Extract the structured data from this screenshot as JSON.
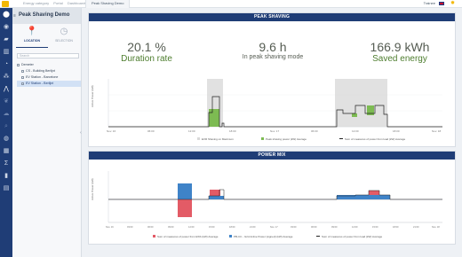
{
  "topbar": {
    "breadcrumbs": [
      "Energy category",
      "Portal",
      "Dashboards"
    ],
    "doc_tab": "Peak Shaving Demo",
    "user": "Trainee"
  },
  "rail_icons": [
    "location-icon",
    "globe-icon",
    "folder-icon",
    "chart-icon",
    "gauge-icon",
    "nodes-icon",
    "peak-icon",
    "leaf-icon",
    "cloud-icon",
    "search-icon",
    "meter-icon",
    "grid-icon",
    "sigma-icon",
    "battery-icon",
    "table-icon"
  ],
  "sidebar": {
    "title": "Peak Shaving Demo",
    "tab_location": "LOCATION",
    "tab_selection": "SELECTION",
    "search_placeholder": "Search",
    "tree": [
      {
        "label": "Demeter",
        "level": 0
      },
      {
        "label": "CS - Building Berlijnt",
        "level": 1
      },
      {
        "label": "EV Station - Barcelone",
        "level": 1
      },
      {
        "label": "EV Station - Berlijnt",
        "level": 1
      }
    ]
  },
  "peak": {
    "title": "PEAK SHAVING",
    "kpis": [
      {
        "value": "20.1 %",
        "label": "Duration rate"
      },
      {
        "value": "9.6 h",
        "label": "In peak shaving mode"
      },
      {
        "value": "166.9 kWh",
        "label": "Saved energy"
      }
    ],
    "chart": {
      "ylabel": "Active Power (kW)",
      "x_ticks": [
        "Nov. 16",
        "06:00",
        "12:00",
        "18:00",
        "Nov. 17",
        "06:00",
        "12:00",
        "18:00",
        "Nov. 18"
      ],
      "legend": [
        "EVR Shaving on Maximum",
        "Peak shaving power (kW) Average",
        "Sum of measures of power from load (kW) Average"
      ]
    }
  },
  "mix": {
    "title": "POWER MIX",
    "chart": {
      "ylabel": "Active Power (kW)",
      "x_ticks": [
        "Nov. 16",
        "03:00",
        "06:00",
        "09:00",
        "12:00",
        "15:00",
        "18:00",
        "21:00",
        "Nov. 17",
        "03:00",
        "06:00",
        "09:00",
        "12:00",
        "15:00",
        "18:00",
        "21:00",
        "Nov. 18"
      ],
      "legend": [
        "Sum of measures of power from ESS (kW) Average",
        "PB-CC - Grid Active Power (signed) (kW) Average",
        "Sum of measures of power from load (kW) Average"
      ]
    }
  },
  "colors": {
    "brand": "#1f3d76",
    "peak_fill": "#7dbb52",
    "ess": "#e35b66",
    "grid": "#3f83c8",
    "load": "#222222",
    "shaving_band": "#d9d9d9"
  }
}
